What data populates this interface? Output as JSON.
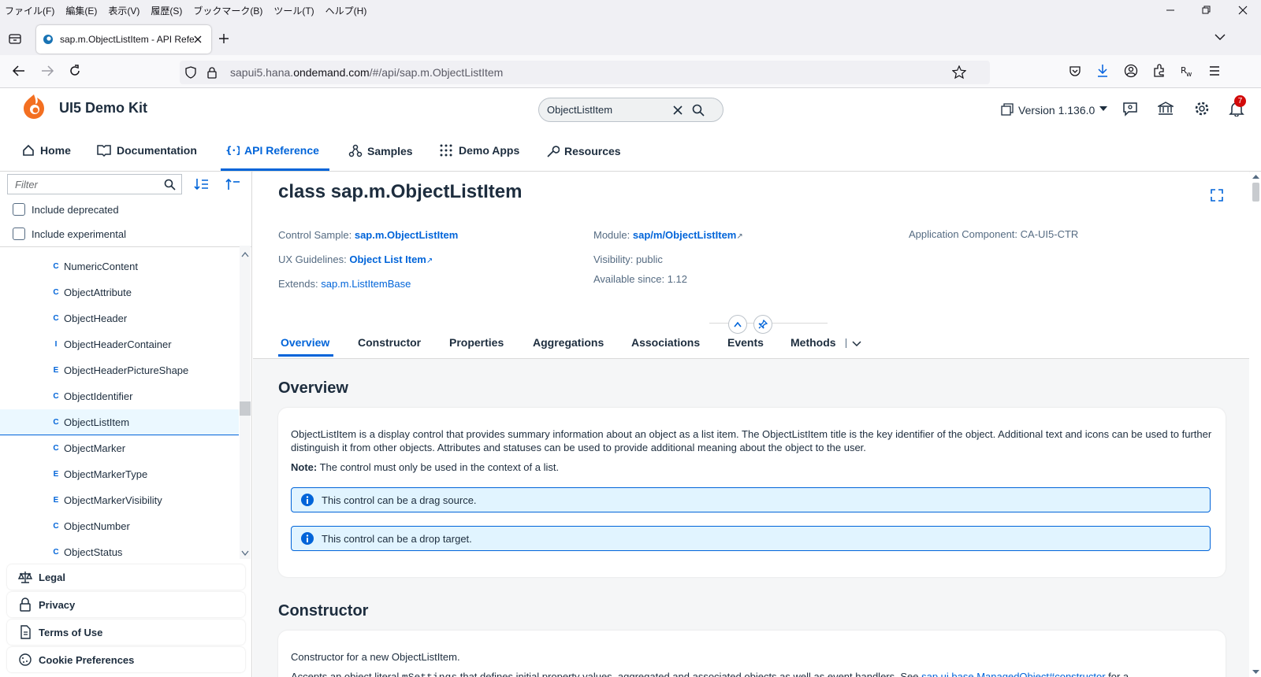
{
  "browser": {
    "menu": [
      "ファイル(F)",
      "編集(E)",
      "表示(V)",
      "履歴(S)",
      "ブックマーク(B)",
      "ツール(T)",
      "ヘルプ(H)"
    ],
    "tab_title": "sap.m.ObjectListItem - API Refe",
    "url_prefix": "sapui5.hana.",
    "url_domain": "ondemand.com",
    "url_path": "/#/api/sap.m.ObjectListItem"
  },
  "header": {
    "brand": "UI5 Demo Kit",
    "search_value": "ObjectListItem",
    "version": "Version 1.136.0",
    "notifications_count": "7",
    "nav": [
      "Home",
      "Documentation",
      "API Reference",
      "Samples",
      "Demo Apps",
      "Resources"
    ]
  },
  "sidebar": {
    "filter_placeholder": "Filter",
    "include_deprecated": "Include deprecated",
    "include_experimental": "Include experimental",
    "tree": [
      {
        "kind": "C",
        "name": "NumericContent"
      },
      {
        "kind": "C",
        "name": "ObjectAttribute"
      },
      {
        "kind": "C",
        "name": "ObjectHeader"
      },
      {
        "kind": "I",
        "name": "ObjectHeaderContainer"
      },
      {
        "kind": "E",
        "name": "ObjectHeaderPictureShape"
      },
      {
        "kind": "C",
        "name": "ObjectIdentifier"
      },
      {
        "kind": "C",
        "name": "ObjectListItem"
      },
      {
        "kind": "C",
        "name": "ObjectMarker"
      },
      {
        "kind": "E",
        "name": "ObjectMarkerType"
      },
      {
        "kind": "E",
        "name": "ObjectMarkerVisibility"
      },
      {
        "kind": "C",
        "name": "ObjectNumber"
      },
      {
        "kind": "C",
        "name": "ObjectStatus"
      }
    ],
    "selected": "ObjectListItem",
    "footer": [
      "Legal",
      "Privacy",
      "Terms of Use",
      "Cookie Preferences"
    ]
  },
  "object": {
    "title": "class sap.m.ObjectListItem",
    "control_sample_label": "Control Sample:",
    "control_sample_value": "sap.m.ObjectListItem",
    "ux_label": "UX Guidelines:",
    "ux_value": "Object List Item",
    "extends_label": "Extends:",
    "extends_value": "sap.m.ListItemBase",
    "module_label": "Module:",
    "module_value": "sap/m/ObjectListItem",
    "visibility": "Visibility: public",
    "available": "Available since: 1.12",
    "app_component": "Application Component: CA-UI5-CTR",
    "tabs": [
      "Overview",
      "Constructor",
      "Properties",
      "Aggregations",
      "Associations",
      "Events",
      "Methods"
    ]
  },
  "overview": {
    "heading": "Overview",
    "text": "ObjectListItem is a display control that provides summary information about an object as a list item. The ObjectListItem title is the key identifier of the object. Additional text and icons can be used to further distinguish it from other objects. Attributes and statuses can be used to provide additional meaning about the object to the user.",
    "note_label": "Note:",
    "note_text": " The control must only be used in the context of a list.",
    "strip1": "This control can be a drag source.",
    "strip2": "This control can be a drop target."
  },
  "constructor": {
    "heading": "Constructor",
    "text1": "Constructor for a new ObjectListItem.",
    "text2_a": "Accepts an object literal ",
    "text2_code": "mSettings",
    "text2_b": " that defines initial property values, aggregated and associated objects as well as event handlers. See ",
    "text2_link": "sap.ui.base.ManagedObject#constructor",
    "text2_c": " for a"
  }
}
